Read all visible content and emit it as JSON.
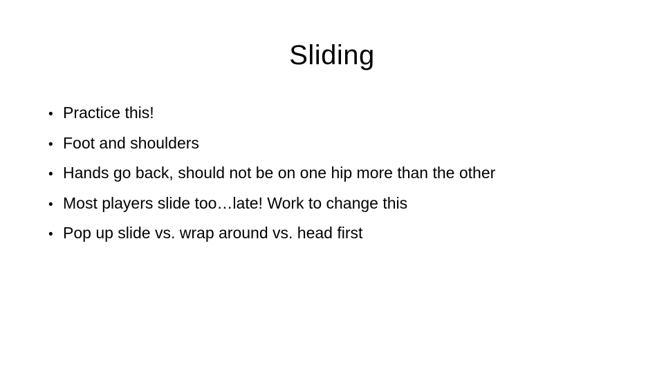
{
  "slide": {
    "title": "Sliding",
    "bullet_glyph": "•",
    "bullets": [
      {
        "text": "Practice this!"
      },
      {
        "text": "Foot and shoulders"
      },
      {
        "text": "Hands go back, should not be on one hip more than the other"
      },
      {
        "text": "Most players slide too…late!  Work to change this"
      },
      {
        "text": "Pop up slide vs. wrap around vs. head first"
      }
    ]
  },
  "colors": {
    "background": "#ffffff",
    "text": "#000000"
  }
}
